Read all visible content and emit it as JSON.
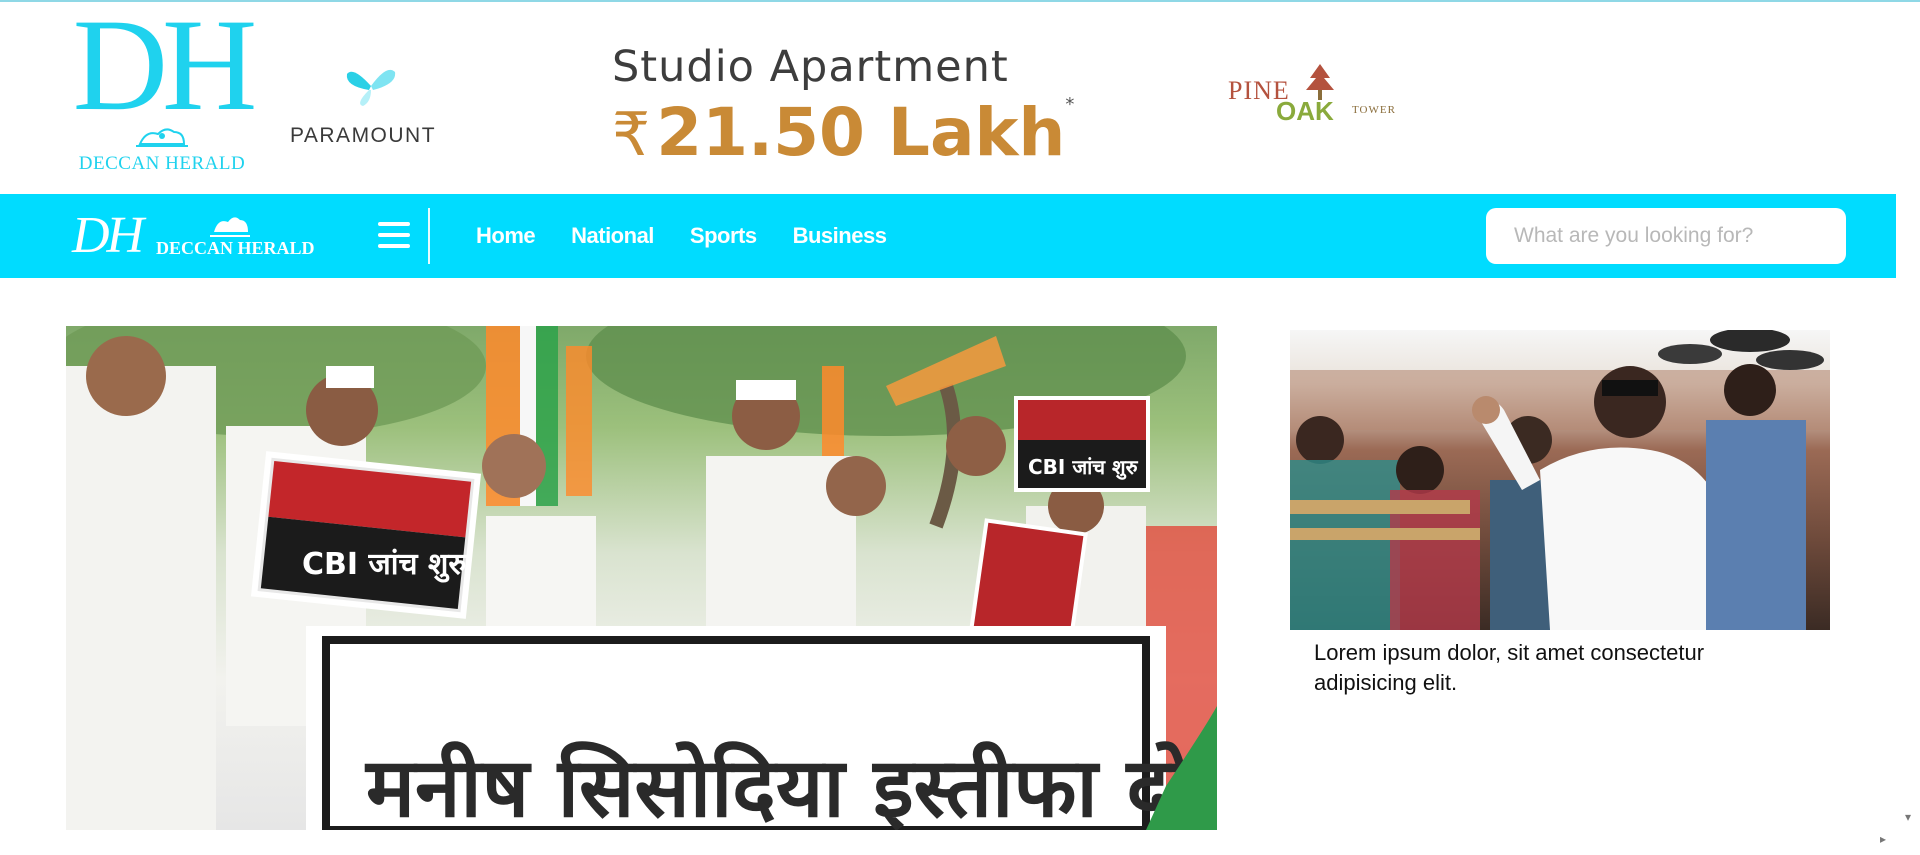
{
  "masthead": {
    "logo_monogram": "DH",
    "logo_name": "DECCAN HERALD"
  },
  "ad": {
    "advertiser": "PARAMOUNT",
    "headline": "Studio Apartment",
    "price_symbol": "₹",
    "price": "21.50 Lakh",
    "price_note": "*",
    "partner_pine": "PINE",
    "partner_oak": "OAK",
    "partner_tower": "TOWER"
  },
  "nav": {
    "logo_monogram": "DH",
    "logo_name": "DECCAN HERALD",
    "links": [
      "Home",
      "National",
      "Sports",
      "Business"
    ],
    "search_placeholder": "What are you looking for?"
  },
  "content": {
    "hero_banner_text": "मनीष सिसोदिया इस्तीफा दो",
    "hero_placard_1": "CBI जांच शुरु",
    "hero_placard_2": "CBI जांच शुरु",
    "side_caption": "Lorem ipsum dolor, sit amet consectetur adipisicing elit."
  },
  "colors": {
    "brand": "#00dcff",
    "logo_cyan": "#1fd2ee",
    "ad_gold": "#c98a36",
    "ad_gray": "#3d3d3d"
  },
  "icons": [
    "menu-icon",
    "scroll-right-icon",
    "scroll-down-icon"
  ]
}
